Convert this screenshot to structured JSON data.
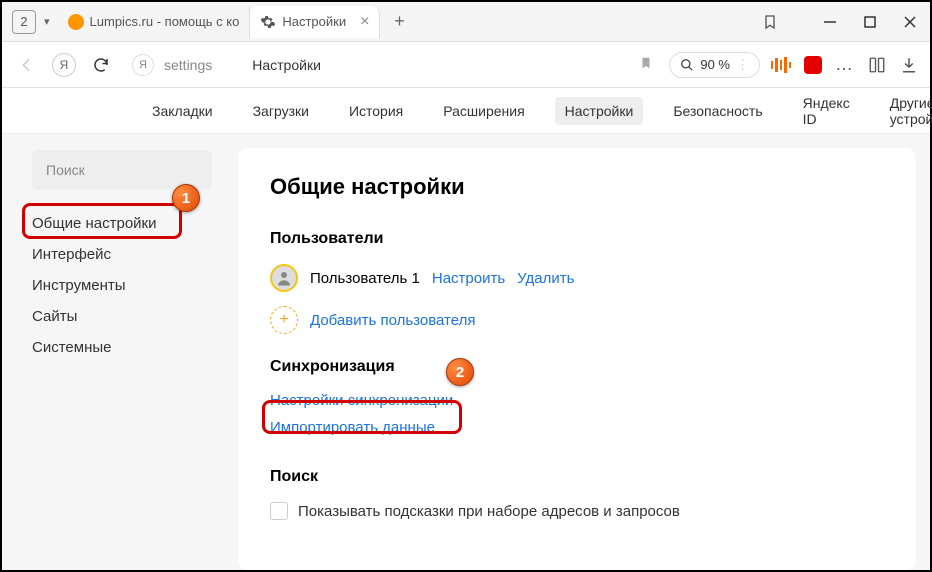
{
  "titlebar": {
    "tab_count": "2",
    "tabs": [
      {
        "label": "Lumpics.ru - помощь с ко"
      },
      {
        "label": "Настройки"
      }
    ]
  },
  "addrbar": {
    "url_text": "settings",
    "url_title": "Настройки",
    "zoom_label": "90 %"
  },
  "settings_nav": {
    "items": [
      "Закладки",
      "Загрузки",
      "История",
      "Расширения",
      "Настройки",
      "Безопасность",
      "Яндекс ID",
      "Другие устройства"
    ],
    "active_index": 4
  },
  "sidebar": {
    "search_placeholder": "Поиск",
    "items": [
      "Общие настройки",
      "Интерфейс",
      "Инструменты",
      "Сайты",
      "Системные"
    ],
    "selected_index": 0
  },
  "content": {
    "heading": "Общие настройки",
    "users_heading": "Пользователи",
    "user_name": "Пользователь 1",
    "user_configure": "Настроить",
    "user_delete": "Удалить",
    "add_user": "Добавить пользователя",
    "sync_heading": "Синхронизация",
    "sync_settings": "Настройки синхронизации",
    "import_data": "Импортировать данные",
    "search_heading": "Поиск",
    "search_checkbox_label": "Показывать подсказки при наборе адресов и запросов"
  },
  "annotations": {
    "badge1": "1",
    "badge2": "2"
  }
}
